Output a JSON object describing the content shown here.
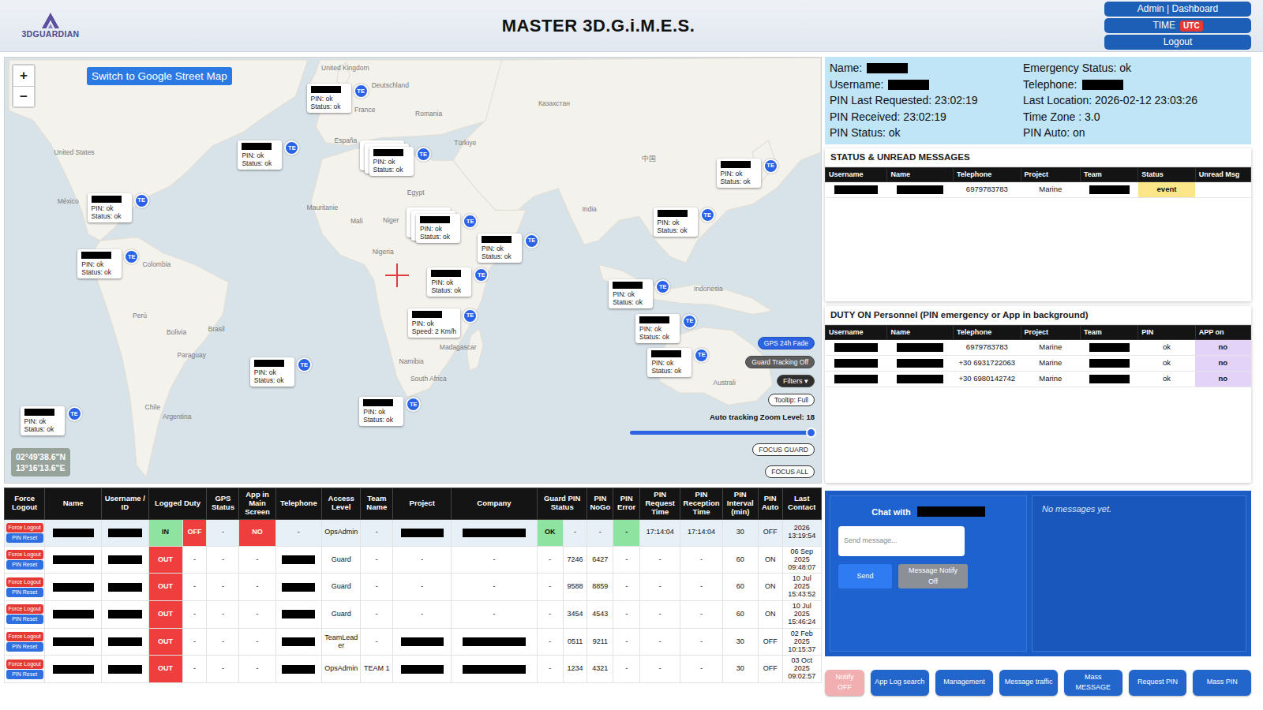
{
  "header": {
    "logo": "3DGUARDIAN",
    "title": "MASTER 3D.G.i.M.E.S.",
    "admin_button": "Admin | Dashboard",
    "time_button": {
      "label": "TIME",
      "badge": "UTC"
    },
    "logout_button": "Logout"
  },
  "map": {
    "zoom_in": "+",
    "zoom_out": "−",
    "switch_button": "Switch to Google Street Map",
    "labels": [
      "United Kingdom",
      "Deutschland",
      "France",
      "Romania",
      "España",
      "Türkiye",
      "Казахстан",
      "United States",
      "México",
      "Colombia",
      "Perú",
      "Bolivia",
      "Brasil",
      "Paraguay",
      "Chile",
      "Argentina",
      "Mali",
      "Niger",
      "Nigeria",
      "Egypt",
      "India",
      "中国",
      "Indonesia",
      "Madagascar",
      "Namibia",
      "South Africa",
      "Australi",
      "Mauritanie"
    ],
    "pins": [
      {
        "redacted": true,
        "pin": "PIN: ok",
        "status": "Status: ok",
        "badge": "TE",
        "stacked": false
      },
      {
        "redacted": true,
        "pin": "PIN: ok",
        "status": "Status: ok",
        "badge": "TE",
        "stacked": false
      },
      {
        "redacted": true,
        "pin": "PIN: ok",
        "status": "Status: ok",
        "badge": "TE",
        "stacked": true
      },
      {
        "redacted": true,
        "pin": "PIN: ok",
        "status": "Status: ok",
        "badge": "TE",
        "stacked": false
      },
      {
        "redacted": true,
        "pin": "PIN: ok",
        "status": "Status: ok",
        "badge": "TE",
        "stacked": false
      },
      {
        "redacted": true,
        "pin": "PIN: ok",
        "status": "Status: ok",
        "badge": "TE",
        "stacked": false
      },
      {
        "redacted": true,
        "pin": "PIN: ok",
        "status": "Status: ok",
        "badge": "TE",
        "stacked": true
      },
      {
        "redacted": true,
        "pin": "PIN: ok",
        "status": "Status: ok",
        "badge": "TE",
        "stacked": false
      },
      {
        "redacted": true,
        "pin": "PIN: ok",
        "status": "Status: ok",
        "badge": "TE",
        "stacked": false
      },
      {
        "redacted": true,
        "pin": "PIN: ok",
        "status": "Status: ok",
        "badge": "TE",
        "stacked": false
      },
      {
        "redacted": true,
        "pin": "PIN: ok",
        "status": "Status: ok",
        "badge": "TE",
        "stacked": false
      },
      {
        "redacted": true,
        "pin": "PIN: ok",
        "status": "Status: ok",
        "badge": "TE",
        "stacked": false
      },
      {
        "redacted": true,
        "pin": "PIN: ok",
        "status": "Speed: 2 Km/h",
        "badge": "TE",
        "stacked": false
      },
      {
        "redacted": true,
        "pin": "PIN: ok",
        "status": "Status: ok",
        "badge": "TE",
        "stacked": false
      },
      {
        "redacted": true,
        "pin": "PIN: ok",
        "status": "Status: ok",
        "badge": "TE",
        "stacked": false
      },
      {
        "redacted": true,
        "pin": "PIN: ok",
        "status": "Status: ok",
        "badge": "TE",
        "stacked": false
      },
      {
        "redacted": true,
        "pin": "PIN: ok",
        "status": "Status: ok",
        "badge": "TE",
        "stacked": false
      }
    ],
    "coords": [
      "02°49'38.6\"N",
      "13°16'13.6\"E"
    ],
    "controls": {
      "gps_fade": "GPS 24h Fade",
      "guard_tracking": "Guard Tracking Off",
      "filters": "Filters ▾",
      "tooltip": "Tooltip: Full",
      "zoom_label": "Auto tracking Zoom Level: 18",
      "zoom_level": 1,
      "focus_guard": "FOCUS GUARD",
      "focus_all": "FOCUS ALL"
    }
  },
  "info": {
    "left": [
      {
        "text": "Name:",
        "redacted": true
      },
      {
        "text": "Username:",
        "redacted": true
      },
      {
        "text": "PIN Last Requested: 23:02:19",
        "redacted": false
      },
      {
        "text": "PIN Received: 23:02:19",
        "redacted": false
      },
      {
        "text": "PIN Status: ok",
        "redacted": false
      }
    ],
    "right": [
      {
        "text": "Emergency Status: ok",
        "redacted": false
      },
      {
        "text": "Telephone:",
        "redacted": true
      },
      {
        "text": "Last Location: 2026-02-12 23:03:26",
        "redacted": false
      },
      {
        "text": "Time Zone : 3.0",
        "redacted": false
      },
      {
        "text": "PIN Auto: on",
        "redacted": false
      }
    ]
  },
  "status_panel": {
    "title": "STATUS & UNREAD MESSAGES",
    "columns": [
      "Username",
      "Name",
      "Telephone",
      "Project",
      "Team",
      "Status",
      "Unread Msg"
    ],
    "rows": [
      [
        {
          "kind": "redacted"
        },
        {
          "kind": "redacted"
        },
        {
          "kind": "text",
          "text": "6979783783"
        },
        {
          "kind": "text",
          "text": "Marine"
        },
        {
          "kind": "redacted"
        },
        {
          "kind": "status",
          "text": "event",
          "color": "#fde68a"
        },
        {
          "kind": "blank"
        }
      ]
    ]
  },
  "duty_panel": {
    "title": "DUTY ON Personnel (PIN emergency or App in background)",
    "columns": [
      "Username",
      "Name",
      "Telephone",
      "Project",
      "Team",
      "PIN",
      "APP on"
    ],
    "rows": [
      [
        {
          "kind": "redacted"
        },
        {
          "kind": "redacted"
        },
        {
          "kind": "text",
          "text": "6979783783"
        },
        {
          "kind": "text",
          "text": "Marine"
        },
        {
          "kind": "redacted"
        },
        {
          "kind": "text",
          "text": "ok"
        },
        {
          "kind": "status",
          "text": "no",
          "color": "#e4d3f8"
        }
      ],
      [
        {
          "kind": "redacted"
        },
        {
          "kind": "redacted"
        },
        {
          "kind": "text",
          "text": "+30 6931722063"
        },
        {
          "kind": "text",
          "text": "Marine"
        },
        {
          "kind": "redacted"
        },
        {
          "kind": "text",
          "text": "ok"
        },
        {
          "kind": "status",
          "text": "no",
          "color": "#e4d3f8"
        }
      ],
      [
        {
          "kind": "redacted"
        },
        {
          "kind": "redacted"
        },
        {
          "kind": "text",
          "text": "+30 6980142742"
        },
        {
          "kind": "text",
          "text": "Marine"
        },
        {
          "kind": "redacted"
        },
        {
          "kind": "text",
          "text": "ok"
        },
        {
          "kind": "status",
          "text": "no",
          "color": "#e4d3f8"
        }
      ]
    ]
  },
  "main_table": {
    "columns": [
      "Force Logout",
      "Name",
      "Username / ID",
      "Logged Duty",
      "GPS Status",
      "App in Main Screen",
      "Telephone",
      "Access Level",
      "Team Name",
      "Project",
      "Company",
      "Guard PIN Status",
      "PIN NoGo",
      "PIN Error",
      "PIN Request Time",
      "PIN Reception Time",
      "PIN Interval (min)",
      "PIN Auto",
      "Last Contact"
    ],
    "rows": [
      {
        "selected": true,
        "cells": [
          {
            "kind": "buttons",
            "buttons": [
              {
                "label": "Force Logout",
                "color": "#e53935"
              },
              {
                "label": "PIN Reset",
                "color": "#2f6fe0"
              }
            ]
          },
          {
            "kind": "redacted"
          },
          {
            "kind": "redacted"
          },
          {
            "kind": "status",
            "text": "IN",
            "color": "#8fe3a0"
          },
          {
            "kind": "status",
            "text": "OFF",
            "color": "#ef3e3e"
          },
          {
            "kind": "text",
            "text": "-"
          },
          {
            "kind": "status",
            "text": "NO",
            "color": "#ef3e3e"
          },
          {
            "kind": "text",
            "text": "-"
          },
          {
            "kind": "text",
            "text": "OpsAdmin"
          },
          {
            "kind": "text",
            "text": "-"
          },
          {
            "kind": "redacted"
          },
          {
            "kind": "redacted"
          },
          {
            "kind": "status",
            "text": "OK",
            "color": "#8fe3a0"
          },
          {
            "kind": "text",
            "text": "-"
          },
          {
            "kind": "text",
            "text": "-"
          },
          {
            "kind": "status",
            "text": "-",
            "color": "#8fe3a0"
          },
          {
            "kind": "text",
            "text": "17:14:04"
          },
          {
            "kind": "text",
            "text": "17:14:04"
          },
          {
            "kind": "text",
            "text": "30"
          },
          {
            "kind": "text",
            "text": "OFF"
          },
          {
            "kind": "text",
            "text": "2026 13:19:54"
          }
        ]
      },
      {
        "selected": false,
        "cells": [
          {
            "kind": "buttons",
            "buttons": [
              {
                "label": "Force Logout",
                "color": "#e53935"
              },
              {
                "label": "PIN Reset",
                "color": "#2f6fe0"
              }
            ]
          },
          {
            "kind": "redacted"
          },
          {
            "kind": "redacted"
          },
          {
            "kind": "status",
            "text": "OUT",
            "color": "#ef3e3e"
          },
          {
            "kind": "text",
            "text": "-"
          },
          {
            "kind": "text",
            "text": "-"
          },
          {
            "kind": "text",
            "text": "-"
          },
          {
            "kind": "redacted"
          },
          {
            "kind": "text",
            "text": "Guard"
          },
          {
            "kind": "text",
            "text": "-"
          },
          {
            "kind": "text",
            "text": "-"
          },
          {
            "kind": "text",
            "text": "-"
          },
          {
            "kind": "text",
            "text": "-"
          },
          {
            "kind": "text",
            "text": "7246"
          },
          {
            "kind": "text",
            "text": "6427"
          },
          {
            "kind": "text",
            "text": "-"
          },
          {
            "kind": "text",
            "text": "-"
          },
          {
            "kind": "text",
            "text": "-"
          },
          {
            "kind": "text",
            "text": "60"
          },
          {
            "kind": "text",
            "text": "ON"
          },
          {
            "kind": "text",
            "text": "06 Sep 2025 09:48:07"
          }
        ]
      },
      {
        "selected": false,
        "cells": [
          {
            "kind": "buttons",
            "buttons": [
              {
                "label": "Force Logout",
                "color": "#e53935"
              },
              {
                "label": "PIN Reset",
                "color": "#2f6fe0"
              }
            ]
          },
          {
            "kind": "redacted"
          },
          {
            "kind": "redacted"
          },
          {
            "kind": "status",
            "text": "OUT",
            "color": "#ef3e3e"
          },
          {
            "kind": "text",
            "text": "-"
          },
          {
            "kind": "text",
            "text": "-"
          },
          {
            "kind": "text",
            "text": "-"
          },
          {
            "kind": "redacted"
          },
          {
            "kind": "text",
            "text": "Guard"
          },
          {
            "kind": "text",
            "text": "-"
          },
          {
            "kind": "text",
            "text": "-"
          },
          {
            "kind": "text",
            "text": "-"
          },
          {
            "kind": "text",
            "text": "-"
          },
          {
            "kind": "text",
            "text": "9588"
          },
          {
            "kind": "text",
            "text": "8859"
          },
          {
            "kind": "text",
            "text": "-"
          },
          {
            "kind": "text",
            "text": "-"
          },
          {
            "kind": "text",
            "text": "-"
          },
          {
            "kind": "text",
            "text": "60"
          },
          {
            "kind": "text",
            "text": "ON"
          },
          {
            "kind": "text",
            "text": "10 Jul 2025 15:43:52"
          }
        ]
      },
      {
        "selected": false,
        "cells": [
          {
            "kind": "buttons",
            "buttons": [
              {
                "label": "Force Logout",
                "color": "#e53935"
              },
              {
                "label": "PIN Reset",
                "color": "#2f6fe0"
              }
            ]
          },
          {
            "kind": "redacted"
          },
          {
            "kind": "redacted"
          },
          {
            "kind": "status",
            "text": "OUT",
            "color": "#ef3e3e"
          },
          {
            "kind": "text",
            "text": "-"
          },
          {
            "kind": "text",
            "text": "-"
          },
          {
            "kind": "text",
            "text": "-"
          },
          {
            "kind": "redacted"
          },
          {
            "kind": "text",
            "text": "Guard"
          },
          {
            "kind": "text",
            "text": "-"
          },
          {
            "kind": "text",
            "text": "-"
          },
          {
            "kind": "text",
            "text": "-"
          },
          {
            "kind": "text",
            "text": "-"
          },
          {
            "kind": "text",
            "text": "3454"
          },
          {
            "kind": "text",
            "text": "4543"
          },
          {
            "kind": "text",
            "text": "-"
          },
          {
            "kind": "text",
            "text": "-"
          },
          {
            "kind": "text",
            "text": "-"
          },
          {
            "kind": "text",
            "text": "60"
          },
          {
            "kind": "text",
            "text": "ON"
          },
          {
            "kind": "text",
            "text": "10 Jul 2025 15:46:24"
          }
        ]
      },
      {
        "selected": false,
        "cells": [
          {
            "kind": "buttons",
            "buttons": [
              {
                "label": "Force Logout",
                "color": "#e53935"
              },
              {
                "label": "PIN Reset",
                "color": "#2f6fe0"
              }
            ]
          },
          {
            "kind": "redacted"
          },
          {
            "kind": "redacted"
          },
          {
            "kind": "status",
            "text": "OUT",
            "color": "#ef3e3e"
          },
          {
            "kind": "text",
            "text": "-"
          },
          {
            "kind": "text",
            "text": "-"
          },
          {
            "kind": "text",
            "text": "-"
          },
          {
            "kind": "redacted"
          },
          {
            "kind": "text",
            "text": "TeamLeader"
          },
          {
            "kind": "text",
            "text": "-"
          },
          {
            "kind": "redacted"
          },
          {
            "kind": "redacted"
          },
          {
            "kind": "text",
            "text": "-"
          },
          {
            "kind": "text",
            "text": "0511"
          },
          {
            "kind": "text",
            "text": "9211"
          },
          {
            "kind": "text",
            "text": "-"
          },
          {
            "kind": "text",
            "text": "-"
          },
          {
            "kind": "text",
            "text": "-"
          },
          {
            "kind": "text",
            "text": "30"
          },
          {
            "kind": "text",
            "text": "OFF"
          },
          {
            "kind": "text",
            "text": "02 Feb 2025 10:15:37"
          }
        ]
      },
      {
        "selected": false,
        "cells": [
          {
            "kind": "buttons",
            "buttons": [
              {
                "label": "Force Logout",
                "color": "#e53935"
              },
              {
                "label": "PIN Reset",
                "color": "#2f6fe0"
              }
            ]
          },
          {
            "kind": "redacted"
          },
          {
            "kind": "redacted"
          },
          {
            "kind": "status",
            "text": "OUT",
            "color": "#ef3e3e"
          },
          {
            "kind": "text",
            "text": "-"
          },
          {
            "kind": "text",
            "text": "-"
          },
          {
            "kind": "text",
            "text": "-"
          },
          {
            "kind": "redacted"
          },
          {
            "kind": "text",
            "text": "OpsAdmin"
          },
          {
            "kind": "text",
            "text": "TEAM 1"
          },
          {
            "kind": "redacted"
          },
          {
            "kind": "redacted"
          },
          {
            "kind": "text",
            "text": "-"
          },
          {
            "kind": "text",
            "text": "1234"
          },
          {
            "kind": "text",
            "text": "4321"
          },
          {
            "kind": "text",
            "text": "-"
          },
          {
            "kind": "text",
            "text": "-"
          },
          {
            "kind": "text",
            "text": "-"
          },
          {
            "kind": "text",
            "text": "30"
          },
          {
            "kind": "text",
            "text": "OFF"
          },
          {
            "kind": "text",
            "text": "03 Oct 2025 09:02:57"
          }
        ]
      }
    ]
  },
  "chat": {
    "title": "Chat with",
    "title_redacted": true,
    "placeholder": "Send message...",
    "send": "Send",
    "notify": "Message Notify Off",
    "empty": "No messages yet."
  },
  "actions": [
    {
      "label": "Notify OFF",
      "color": "#f2afb1"
    },
    {
      "label": "App Log search",
      "color": "#2266cc"
    },
    {
      "label": "Management",
      "color": "#2266cc"
    },
    {
      "label": "Message traffic",
      "color": "#2266cc"
    },
    {
      "label": "Mass MESSAGE",
      "color": "#2266cc"
    },
    {
      "label": "Request PIN",
      "color": "#2266cc"
    },
    {
      "label": "Mass PIN",
      "color": "#2266cc"
    }
  ]
}
